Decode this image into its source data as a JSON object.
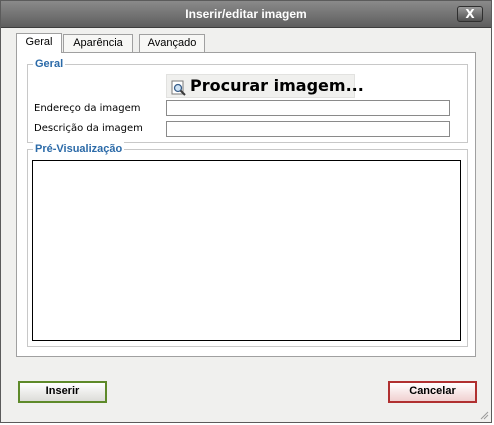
{
  "dialog": {
    "title": "Inserir/editar imagem",
    "close_label": "X"
  },
  "tabs": [
    {
      "label": "Geral",
      "active": true
    },
    {
      "label": "Aparência",
      "active": false
    },
    {
      "label": "Avançado",
      "active": false
    }
  ],
  "general": {
    "legend": "Geral",
    "browse_label": "Procurar imagem...",
    "browse_icon": "search-icon",
    "address_label": "Endereço da imagem",
    "address_value": "",
    "description_label": "Descrição da imagem",
    "description_value": ""
  },
  "preview": {
    "legend": "Pré-Visualização"
  },
  "buttons": {
    "insert": "Inserir",
    "cancel": "Cancelar"
  },
  "colors": {
    "legend": "#2b6aa8",
    "insert_border": "#5e8a2a",
    "cancel_border": "#b03030"
  }
}
